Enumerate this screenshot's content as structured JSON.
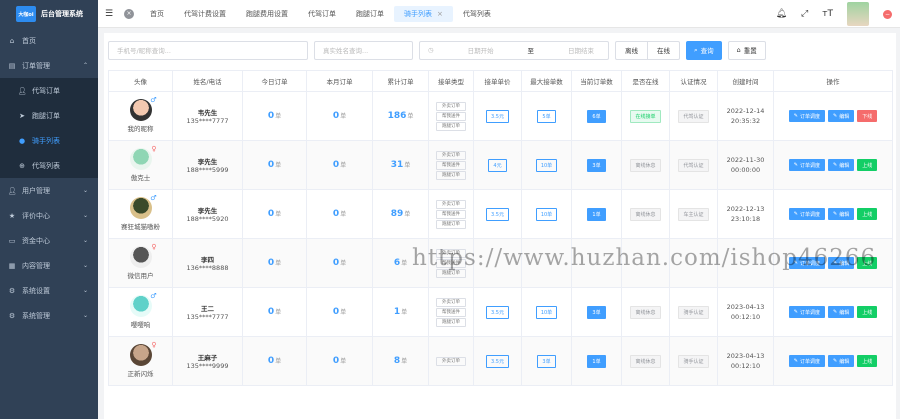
{
  "app": {
    "logo_text": "大咖oi",
    "title": "后台管理系统"
  },
  "sidebar": {
    "items": [
      {
        "label": "首页",
        "icon": "home-icon"
      },
      {
        "label": "订单管理",
        "icon": "order-icon",
        "expanded": true
      },
      {
        "label": "代驾订单",
        "icon": "user-icon",
        "sub": true
      },
      {
        "label": "跑腿订单",
        "icon": "send-icon",
        "sub": true
      },
      {
        "label": "骑手列表",
        "icon": "dot-icon",
        "sub": true,
        "active": true
      },
      {
        "label": "代驾列表",
        "icon": "plus-circle-icon",
        "sub": true
      },
      {
        "label": "用户管理",
        "icon": "user-icon"
      },
      {
        "label": "评价中心",
        "icon": "star-icon"
      },
      {
        "label": "资金中心",
        "icon": "money-icon"
      },
      {
        "label": "内容管理",
        "icon": "content-icon"
      },
      {
        "label": "系统设置",
        "icon": "settings-icon"
      },
      {
        "label": "系统管理",
        "icon": "system-icon"
      }
    ]
  },
  "tabs": [
    {
      "label": "首页"
    },
    {
      "label": "代驾计费设置"
    },
    {
      "label": "跑腿费用设置"
    },
    {
      "label": "代驾订单"
    },
    {
      "label": "跑腿订单"
    },
    {
      "label": "骑手列表",
      "active": true
    },
    {
      "label": "代驾列表"
    }
  ],
  "filters": {
    "keyword_placeholder": "手机号/昵称查询...",
    "name_placeholder": "真实姓名查询...",
    "date_start_placeholder": "日期开始",
    "date_sep": "至",
    "date_end_placeholder": "日期结束",
    "seg_left": "离线",
    "seg_right": "在线",
    "search_label": "查询",
    "reset_label": "重置"
  },
  "table": {
    "headers": [
      "头像",
      "姓名/电话",
      "今日订单",
      "本月订单",
      "累计订单",
      "接单类型",
      "接单单价",
      "最大接单数",
      "当前订单数",
      "是否在线",
      "认证情况",
      "创建时间",
      "操作"
    ],
    "unit": "单",
    "rows": [
      {
        "nick": "我的昵称",
        "name": "韦先生",
        "phone": "135****7777",
        "today": "0",
        "month": "0",
        "total": "186",
        "types": [
          "外卖订单",
          "帮我送件",
          "跑腿订单"
        ],
        "price": "3.5元",
        "max": "5单",
        "current": "6单",
        "online": "在线接单",
        "online_on": true,
        "auth": "代驾认证",
        "date": "2022-12-14",
        "time": "20:35:32",
        "ops": [
          "订单调度",
          "编辑",
          "下线"
        ],
        "av": [
          "#f4c9b0",
          "#333"
        ]
      },
      {
        "nick": "傲克士",
        "name": "李先生",
        "phone": "188****5999",
        "today": "0",
        "month": "0",
        "total": "31",
        "types": [
          "外卖订单",
          "帮我送件",
          "跑腿订单"
        ],
        "price": "4元",
        "max": "10单",
        "current": "3单",
        "online": "离线休息",
        "online_on": false,
        "auth": "代驾认证",
        "date": "2022-11-30",
        "time": "00:00:00",
        "ops": [
          "订单调度",
          "编辑",
          "上线"
        ],
        "av": [
          "#8fd6b4",
          "#e9f5ee"
        ]
      },
      {
        "nick": "赛狂城猫嗷粉",
        "name": "李先生",
        "phone": "188****5920",
        "today": "0",
        "month": "0",
        "total": "89",
        "types": [
          "外卖订单",
          "帮我送件",
          "跑腿订单"
        ],
        "price": "3.5元",
        "max": "10单",
        "current": "1单",
        "online": "离线休息",
        "online_on": false,
        "auth": "车主认证",
        "date": "2022-12-13",
        "time": "23:10:18",
        "ops": [
          "订单调度",
          "编辑",
          "上线"
        ],
        "av": [
          "#3a4a2a",
          "#d9c08a"
        ]
      },
      {
        "nick": "微信用户",
        "name": "李四",
        "phone": "136****8888",
        "today": "0",
        "month": "0",
        "total": "6",
        "types": [
          "外卖订单",
          "帮我送件",
          "跑腿订单"
        ],
        "price": "",
        "max": "",
        "current": "",
        "online": "",
        "online_on": false,
        "auth": "",
        "date": "",
        "time": "",
        "ops": [
          "订单调度",
          "编辑",
          "上线"
        ],
        "av": [
          "#555",
          "#eee"
        ]
      },
      {
        "nick": "嘤嘤响",
        "name": "王二",
        "phone": "135****7777",
        "today": "0",
        "month": "0",
        "total": "1",
        "types": [
          "外卖订单",
          "帮我送件",
          "跑腿订单"
        ],
        "price": "3.5元",
        "max": "10单",
        "current": "3单",
        "online": "离线休息",
        "online_on": false,
        "auth": "骑手认证",
        "date": "2023-04-13",
        "time": "00:12:10",
        "ops": [
          "订单调度",
          "编辑",
          "上线"
        ],
        "av": [
          "#5fd1c9",
          "#e6fbf8"
        ]
      },
      {
        "nick": "正新闪烁",
        "name": "王麻子",
        "phone": "135****9999",
        "today": "0",
        "month": "0",
        "total": "8",
        "types": [
          "外卖订单"
        ],
        "price": "3.5元",
        "max": "3单",
        "current": "1单",
        "online": "离线休息",
        "online_on": false,
        "auth": "骑手认证",
        "date": "2023-04-13",
        "time": "00:12:10",
        "ops": [
          "订单调度",
          "编辑",
          "上线"
        ],
        "av": [
          "#c7a58a",
          "#5a4636"
        ]
      }
    ]
  },
  "watermark": "https://www.huzhan.com/ishop46266",
  "colors": {
    "sidebar": "#304156",
    "primary": "#409eff",
    "danger": "#f56c6c",
    "success": "#13ce66"
  }
}
